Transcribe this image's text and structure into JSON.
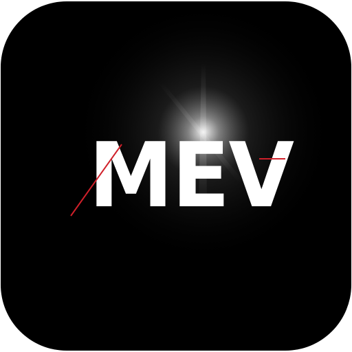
{
  "app_icon": {
    "wordmark": "MEV",
    "background_color": "#000000",
    "text_color": "#ffffff",
    "accent_color": "#d0202a",
    "glow_color": "#ffffff"
  }
}
